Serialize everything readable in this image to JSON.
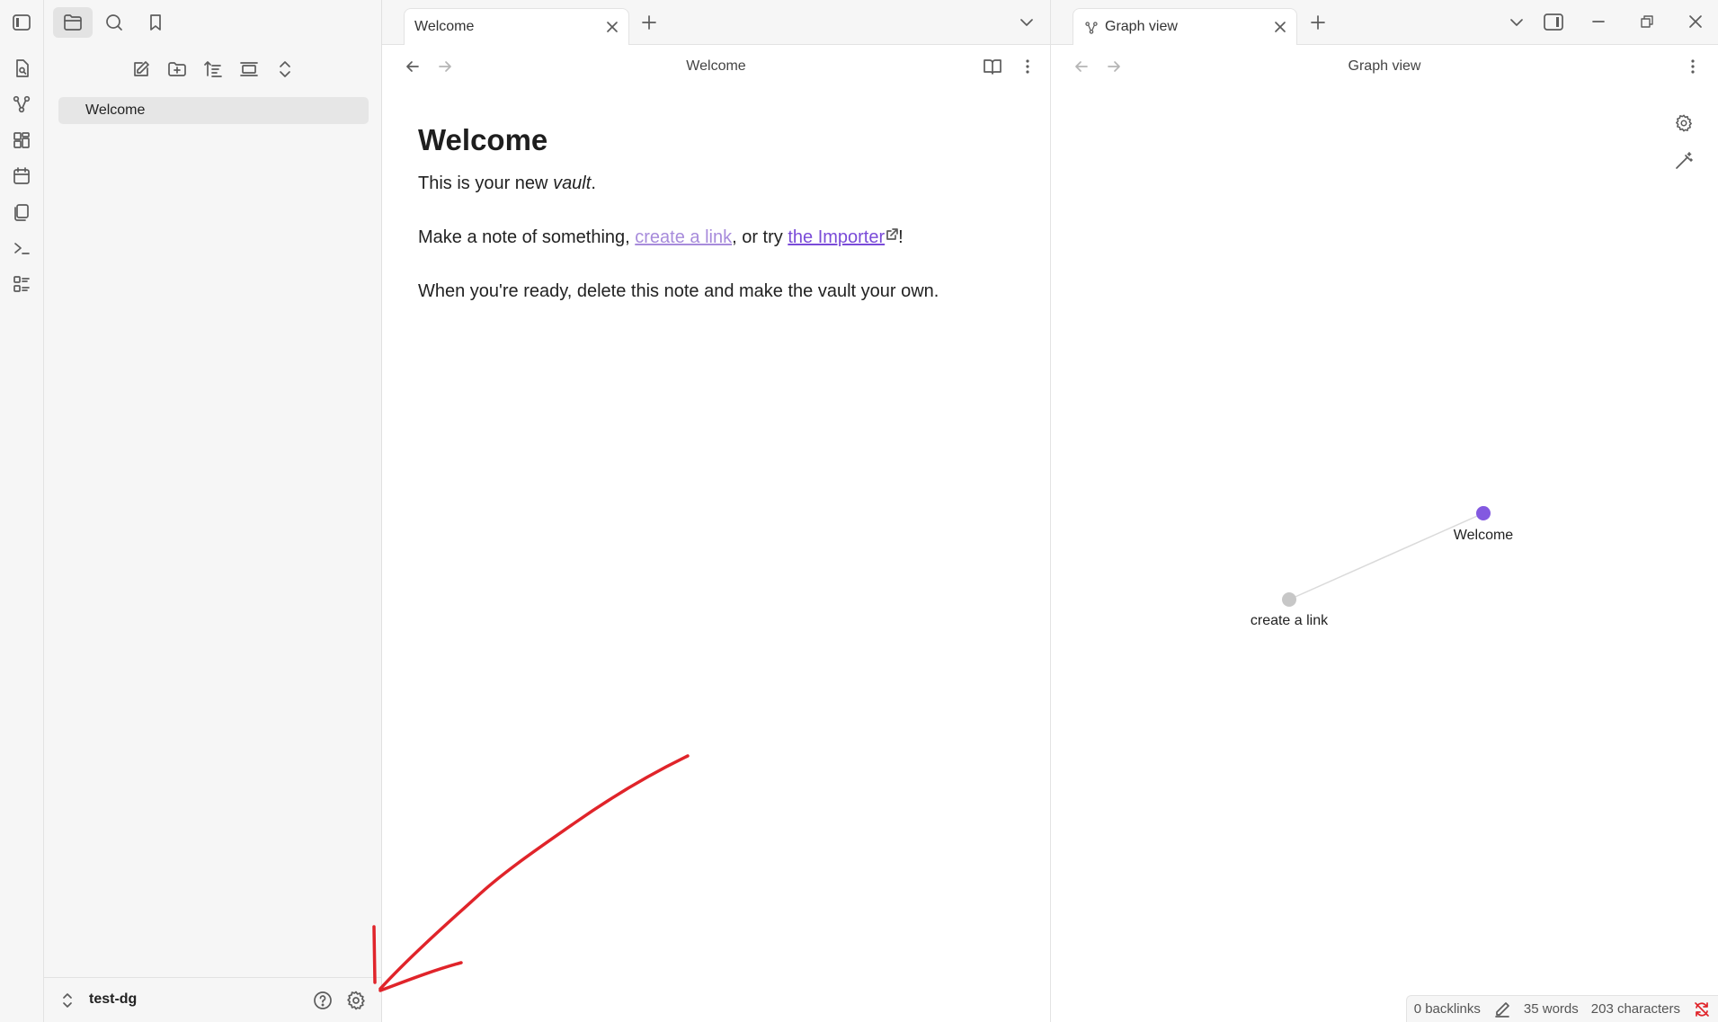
{
  "ribbon": {
    "icons": [
      "sidebar-toggle-icon",
      "open-quick-switcher-icon",
      "graph-view-icon",
      "canvas-icon",
      "daily-note-icon",
      "templates-icon",
      "command-palette-icon",
      "bases-icon"
    ]
  },
  "sidebar": {
    "tabs": [
      "files-icon",
      "search-icon",
      "bookmark-icon"
    ],
    "actions": [
      "new-note-icon",
      "new-folder-icon",
      "sort-icon",
      "auto-reveal-icon",
      "collapse-all-icon"
    ],
    "files": [
      {
        "label": "Welcome"
      }
    ],
    "vault": {
      "name": "test-dg"
    }
  },
  "left_pane": {
    "tab": {
      "title": "Welcome"
    },
    "header": {
      "title": "Welcome"
    },
    "doc": {
      "heading": "Welcome",
      "line1_before": "This is your new ",
      "line1_em": "vault",
      "line1_after": ".",
      "line2_before": "Make a note of something, ",
      "line2_link": "create a link",
      "line2_mid": ", or try ",
      "line2_ext": "the Importer",
      "line2_after": "!",
      "line3": "When you're ready, delete this note and make the vault your own."
    }
  },
  "right_pane": {
    "tab": {
      "title": "Graph view"
    },
    "header": {
      "title": "Graph view"
    },
    "graph": {
      "nodes": [
        {
          "label": "Welcome",
          "color": "#8359e0"
        },
        {
          "label": "create a link",
          "color": "#c7c7c7"
        }
      ]
    }
  },
  "status": {
    "backlinks": "0 backlinks",
    "words": "35 words",
    "chars": "203 characters"
  },
  "colors": {
    "accent": "#8359e0",
    "annotation": "#e0242a"
  }
}
